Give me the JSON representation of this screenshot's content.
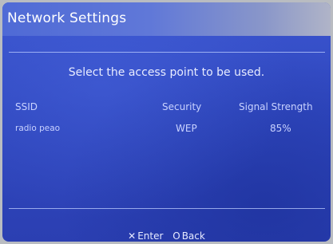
{
  "window": {
    "title": "Network Settings"
  },
  "main": {
    "instruction": "Select the access point to be used."
  },
  "table": {
    "columns": [
      "SSID",
      "Security",
      "Signal Strength"
    ],
    "rows": [
      {
        "ssid": "radio peao",
        "security": "WEP",
        "signal": "85%"
      }
    ]
  },
  "footer": {
    "enter": {
      "symbol": "✕",
      "label": "Enter",
      "icon": "cross-button-icon"
    },
    "back": {
      "symbol": "O",
      "label": "Back",
      "icon": "circle-button-icon"
    }
  },
  "colors": {
    "background": "#3048c0",
    "title_gradient_left": "#4f6ad6",
    "separator": "#bec9ff",
    "text": "#c9d2ff"
  }
}
